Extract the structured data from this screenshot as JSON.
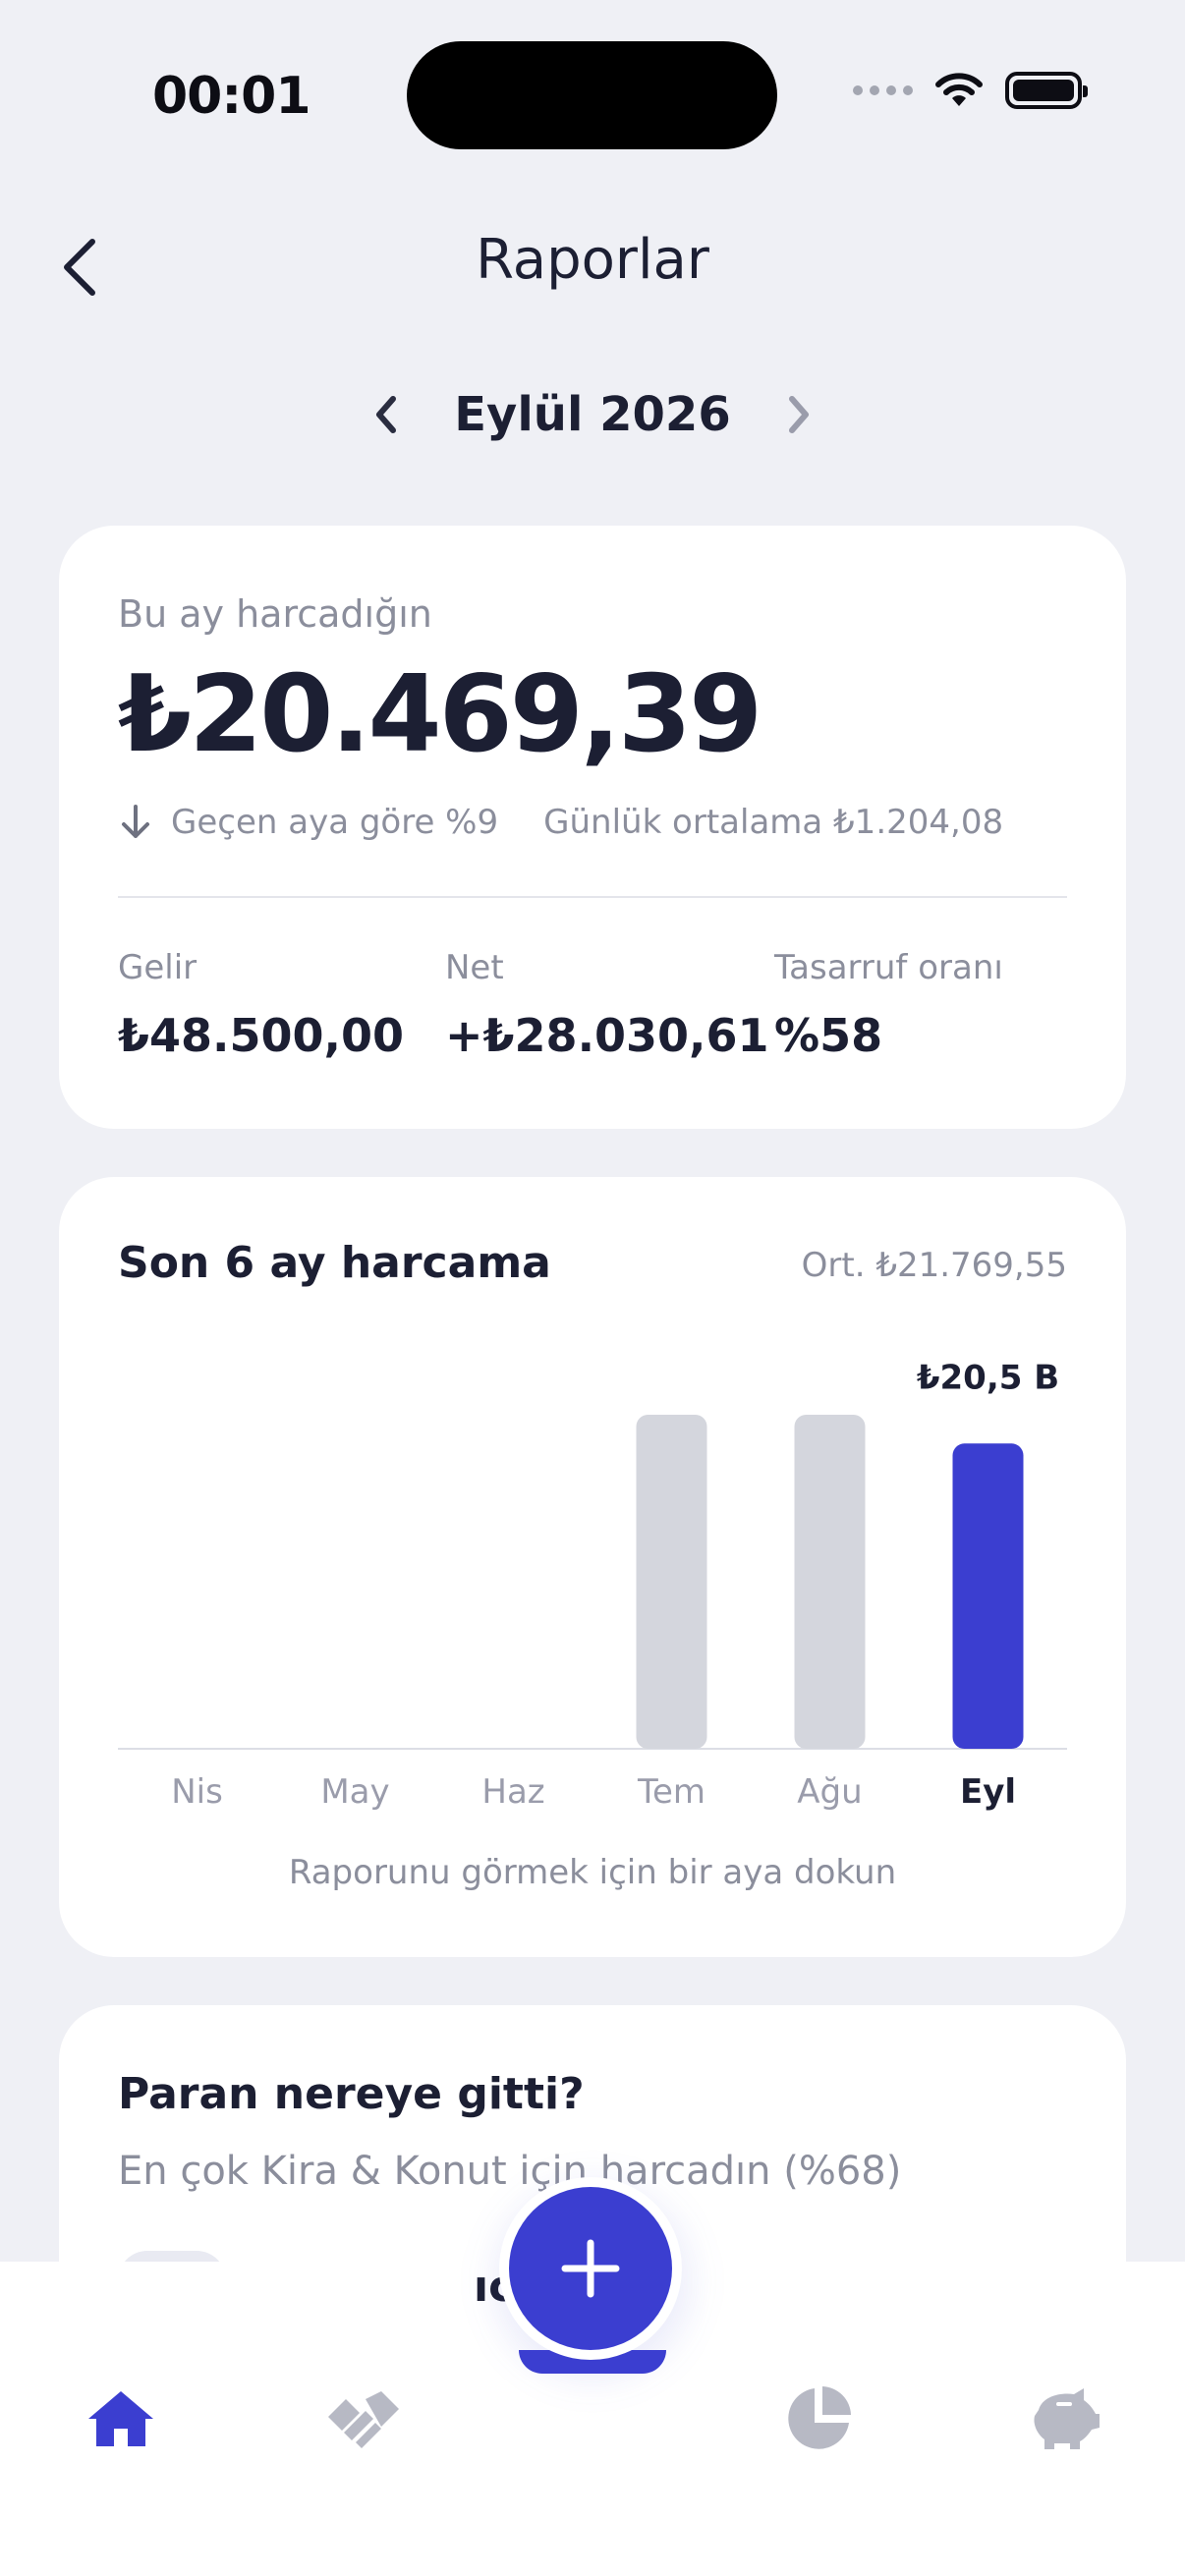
{
  "status_bar": {
    "time": "00:01"
  },
  "header": {
    "title": "Raporlar",
    "month": "Eylül 2026"
  },
  "summary": {
    "label": "Bu ay harcadığın",
    "amount": "₺20.469,39",
    "change_text": "Geçen aya göre %9",
    "daily_avg": "Günlük ortalama ₺1.204,08",
    "stats": [
      {
        "label": "Gelir",
        "value": "₺48.500,00"
      },
      {
        "label": "Net",
        "value": "+₺28.030,61"
      },
      {
        "label": "Tasarruf oranı",
        "value": "%58"
      }
    ]
  },
  "chart_card": {
    "title": "Son 6 ay harcama",
    "average": "Ort. ₺21.769,55",
    "hint": "Raporunu görmek için bir aya dokun"
  },
  "chart_data": {
    "type": "bar",
    "categories": [
      "Nis",
      "May",
      "Haz",
      "Tem",
      "Ağu",
      "Eyl"
    ],
    "values": [
      0,
      0,
      0,
      22400,
      22400,
      20469.39
    ],
    "highlight_index": 5,
    "highlight_label": "₺20,5 B",
    "colors": {
      "default": "#d4d6dd",
      "highlight": "#3b3ed0"
    }
  },
  "where_card": {
    "title": "Paran nereye gitti?",
    "subtitle": "En çok Kira & Konut için harcadın (%68)"
  },
  "tabbar": {
    "tabs": [
      {
        "icon": "home-icon",
        "active": true
      },
      {
        "icon": "handshake-icon",
        "active": false
      },
      {
        "icon": "pie-chart-icon",
        "active": false
      },
      {
        "icon": "piggy-bank-icon",
        "active": false
      }
    ],
    "fab_icon": "plus-icon",
    "accent": "#3b3ed0"
  }
}
